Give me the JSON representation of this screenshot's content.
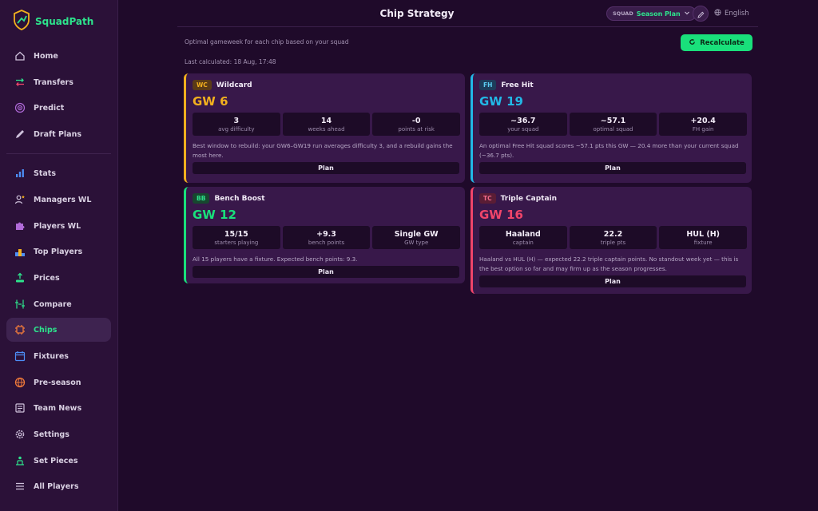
{
  "app": {
    "name": "SquadPath"
  },
  "sidebar": {
    "items": [
      {
        "label": "Home",
        "icon": "home-icon"
      },
      {
        "label": "Transfers",
        "icon": "transfers-icon"
      },
      {
        "label": "Predict",
        "icon": "target-icon"
      },
      {
        "label": "Draft Plans",
        "icon": "pencil-icon"
      },
      {
        "label": "Stats",
        "icon": "bar-chart-icon"
      },
      {
        "label": "Managers WL",
        "icon": "user-star-icon"
      },
      {
        "label": "Players WL",
        "icon": "puzzle-icon"
      },
      {
        "label": "Top Players",
        "icon": "podium-icon"
      },
      {
        "label": "Prices",
        "icon": "price-icon"
      },
      {
        "label": "Compare",
        "icon": "compare-icon"
      },
      {
        "label": "Chips",
        "icon": "chip-icon"
      },
      {
        "label": "Fixtures",
        "icon": "calendar-icon"
      },
      {
        "label": "Pre-season",
        "icon": "globe-icon"
      },
      {
        "label": "Team News",
        "icon": "news-icon"
      },
      {
        "label": "Settings",
        "icon": "gear-icon"
      },
      {
        "label": "Set Pieces",
        "icon": "set-pieces-icon"
      },
      {
        "label": "All Players",
        "icon": "list-icon"
      }
    ]
  },
  "header": {
    "title": "Chip Strategy",
    "plan_label": "SQUAD",
    "plan_value": "Season Plan",
    "language": "English"
  },
  "main": {
    "subtitle": "Optimal gameweek for each chip based on your squad",
    "last_calculated": "Last calculated: 18 Aug, 17:48",
    "recalculate_label": "Recalculate"
  },
  "cards": [
    {
      "tag": "WC",
      "name": "Wildcard",
      "gw": "GW 6",
      "stats": [
        {
          "value": "3",
          "label": "avg difficulty"
        },
        {
          "value": "14",
          "label": "weeks ahead"
        },
        {
          "value": "-0",
          "label": "points at risk"
        }
      ],
      "description": "Best window to rebuild: your GW6–GW19 run averages difficulty 3, and a rebuild gains the most here.",
      "button": "Plan"
    },
    {
      "tag": "FH",
      "name": "Free Hit",
      "gw": "GW 19",
      "stats": [
        {
          "value": "~36.7",
          "label": "your squad"
        },
        {
          "value": "~57.1",
          "label": "optimal squad"
        },
        {
          "value": "+20.4",
          "label": "FH gain"
        }
      ],
      "description": "An optimal Free Hit squad scores ~57.1 pts this GW — 20.4 more than your current squad (~36.7 pts).",
      "button": "Plan"
    },
    {
      "tag": "BB",
      "name": "Bench Boost",
      "gw": "GW 12",
      "stats": [
        {
          "value": "15/15",
          "label": "starters playing"
        },
        {
          "value": "+9.3",
          "label": "bench points"
        },
        {
          "value": "Single GW",
          "label": "GW type"
        }
      ],
      "description": "All 15 players have a fixture. Expected bench points: 9.3.",
      "button": "Plan"
    },
    {
      "tag": "TC",
      "name": "Triple Captain",
      "gw": "GW 16",
      "stats": [
        {
          "value": "Haaland",
          "label": "captain"
        },
        {
          "value": "22.2",
          "label": "triple pts"
        },
        {
          "value": "HUL (H)",
          "label": "fixture"
        }
      ],
      "description": "Haaland vs HUL (H) — expected 22.2 triple captain points. No standout week yet — this is the best option so far and may firm up as the season progresses.",
      "button": "Plan"
    }
  ],
  "colors": {
    "accent": "#2de38c",
    "wildcard": "#f2b01e",
    "free_hit": "#22b8e6",
    "bench_boost": "#19e07b",
    "triple_captain": "#f0456a"
  }
}
